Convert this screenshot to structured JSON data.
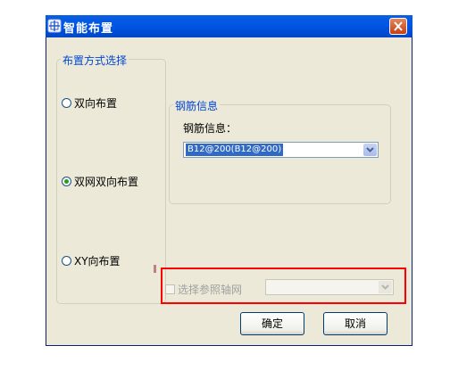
{
  "window": {
    "title": "智能布置"
  },
  "layout_group": {
    "legend": "布置方式选择",
    "options": [
      {
        "label": "双向布置",
        "checked": false
      },
      {
        "label": "双网双向布置",
        "checked": true
      },
      {
        "label": "XY向布置",
        "checked": false
      }
    ]
  },
  "steel_group": {
    "legend": "钢筋信息",
    "field_label": "钢筋信息：",
    "selected_value": "B12@200(B12@200)"
  },
  "axis": {
    "checkbox_label": "选择参照轴网",
    "checked": false,
    "enabled": false,
    "value": ""
  },
  "buttons": {
    "ok": "确定",
    "cancel": "取消"
  },
  "colors": {
    "titlebar": "#0055e5",
    "legend": "#0046d5",
    "highlight": "#ff0000",
    "selection": "#316ac5"
  }
}
